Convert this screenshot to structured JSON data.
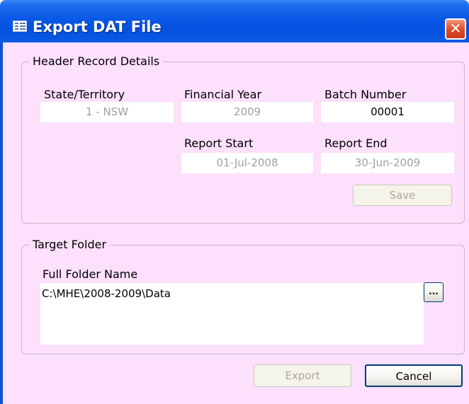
{
  "window": {
    "title": "Export DAT File",
    "close_glyph": "✕"
  },
  "header_group": {
    "caption": "Header Record Details",
    "state_label": "State/Territory",
    "state_value": "1 - NSW",
    "year_label": "Financial Year",
    "year_value": "2009",
    "batch_label": "Batch Number",
    "batch_value": "00001",
    "start_label": "Report Start",
    "start_value": "01-Jul-2008",
    "end_label": "Report End",
    "end_value": "30-Jun-2009",
    "save_label": "Save"
  },
  "target_group": {
    "caption": "Target Folder",
    "folder_label": "Full Folder Name",
    "folder_value": "C:\\MHE\\2008-2009\\Data",
    "browse_label": "..."
  },
  "footer": {
    "export_label": "Export",
    "cancel_label": "Cancel"
  },
  "colors": {
    "titlebar": "#0a58e6",
    "client_background": "#fce0fc",
    "close_button": "#e0502a",
    "disabled_text": "#a0a0a0"
  },
  "icons": {
    "title": "form-icon",
    "close": "close-icon",
    "browse": "ellipsis-icon"
  }
}
